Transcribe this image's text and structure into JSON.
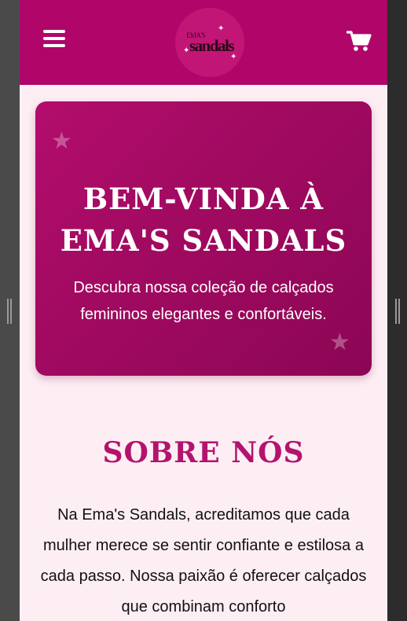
{
  "header": {
    "logo": {
      "small_text": "EMA'S",
      "big_text": "sandals"
    },
    "menu_icon": "hamburger-icon",
    "cart_icon": "shopping-cart-icon",
    "background": "#b0066a"
  },
  "hero": {
    "title_line1": "BEM-VINDA À",
    "title_line2": "EMA'S SANDALS",
    "subtitle": "Descubra nossa coleção de calçados femininos elegantes e confortáveis.",
    "decoration_icon": "star-icon"
  },
  "about": {
    "title": "SOBRE NÓS",
    "text": "Na Ema's Sandals, acreditamos que cada mulher merece se sentir confiante e estilosa a cada passo. Nossa paixão é oferecer calçados que combinam conforto"
  },
  "colors": {
    "accent": "#b3136e",
    "page_background": "#fdeef4"
  }
}
